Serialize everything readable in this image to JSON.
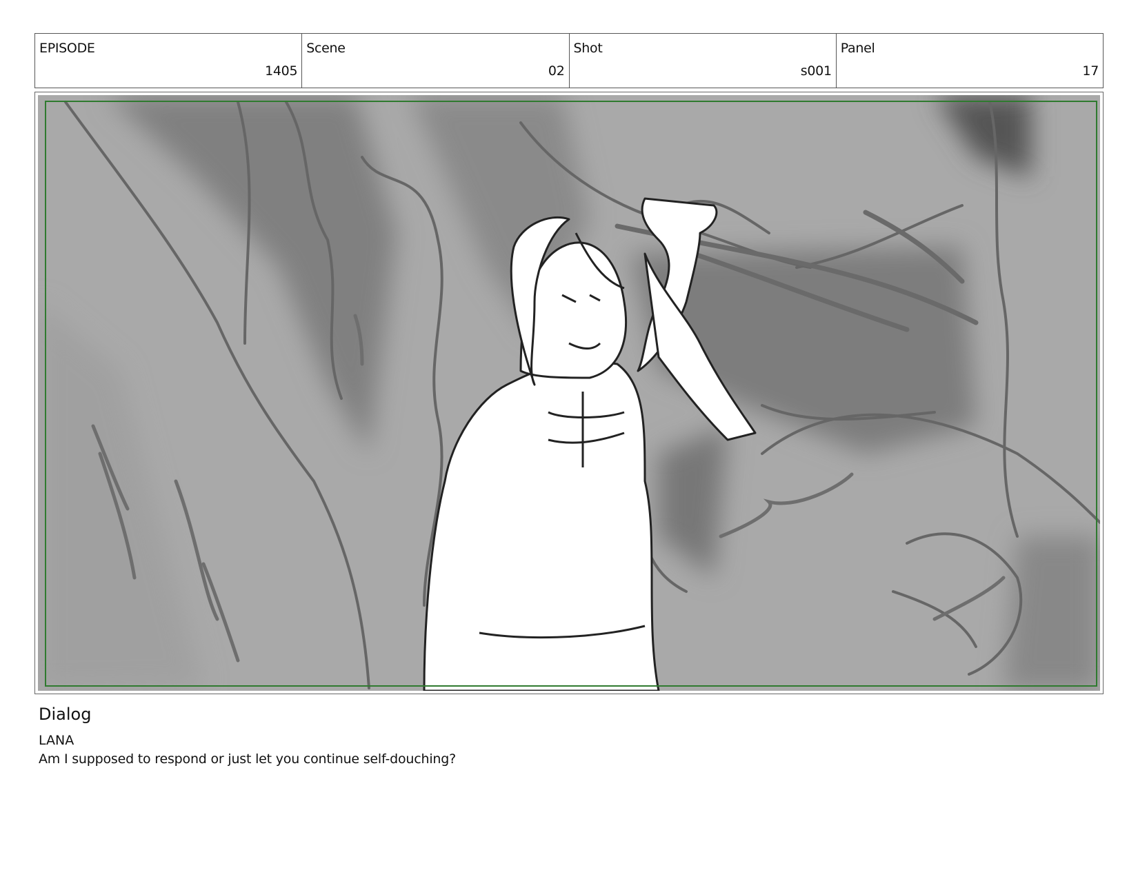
{
  "header": {
    "episode": {
      "label": "EPISODE",
      "value": "1405"
    },
    "scene": {
      "label": "Scene",
      "value": "02"
    },
    "shot": {
      "label": "Shot",
      "value": "s001"
    },
    "panel": {
      "label": "Panel",
      "value": "17"
    }
  },
  "panel_image": {
    "subject": "storyboard-sketch-woman-in-cave",
    "colors": {
      "background": "#a9a9a9",
      "dark": "#7a7a7a",
      "light": "#bdbdbd",
      "figure": "#ffffff",
      "frame": "#2f7a2f"
    }
  },
  "dialog": {
    "title": "Dialog",
    "character": "LANA",
    "line": "Am I supposed to respond or just let you continue self-douching?"
  }
}
